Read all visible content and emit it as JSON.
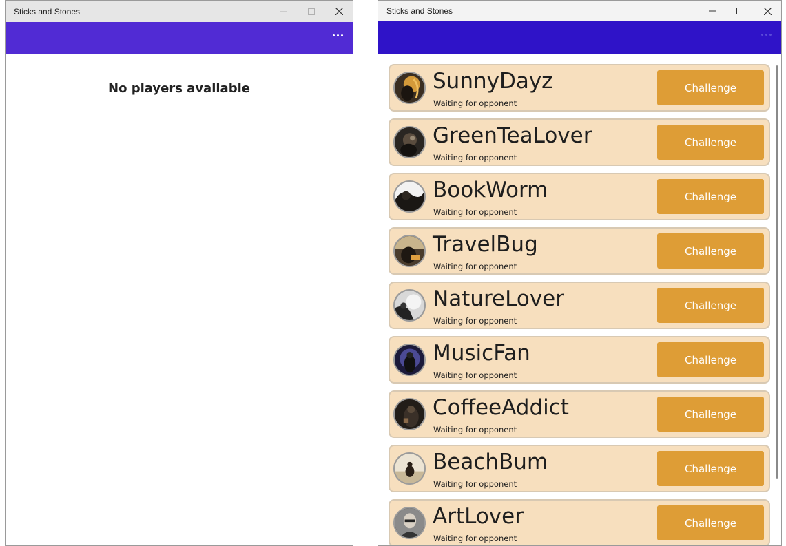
{
  "left_window": {
    "title": "Sticks and Stones",
    "empty_message": "No players available"
  },
  "right_window": {
    "title": "Sticks and Stones",
    "players": [
      {
        "name": "SunnyDayz",
        "status": "Waiting for opponent",
        "action": "Challenge"
      },
      {
        "name": "GreenTeaLover",
        "status": "Waiting for opponent",
        "action": "Challenge"
      },
      {
        "name": "BookWorm",
        "status": "Waiting for opponent",
        "action": "Challenge"
      },
      {
        "name": "TravelBug",
        "status": "Waiting for opponent",
        "action": "Challenge"
      },
      {
        "name": "NatureLover",
        "status": "Waiting for opponent",
        "action": "Challenge"
      },
      {
        "name": "MusicFan",
        "status": "Waiting for opponent",
        "action": "Challenge"
      },
      {
        "name": "CoffeeAddict",
        "status": "Waiting for opponent",
        "action": "Challenge"
      },
      {
        "name": "BeachBum",
        "status": "Waiting for opponent",
        "action": "Challenge"
      },
      {
        "name": "ArtLover",
        "status": "Waiting for opponent",
        "action": "Challenge"
      }
    ]
  },
  "icons": {
    "minimize": "minimize-icon",
    "maximize": "maximize-icon",
    "close": "close-icon",
    "more": "more-options-icon",
    "avatar": "player-avatar"
  },
  "colors": {
    "left_appbar": "#512bd4",
    "right_appbar": "#2f13c8",
    "card_background": "#f7dfbe",
    "challenge_button": "#de9d36"
  }
}
